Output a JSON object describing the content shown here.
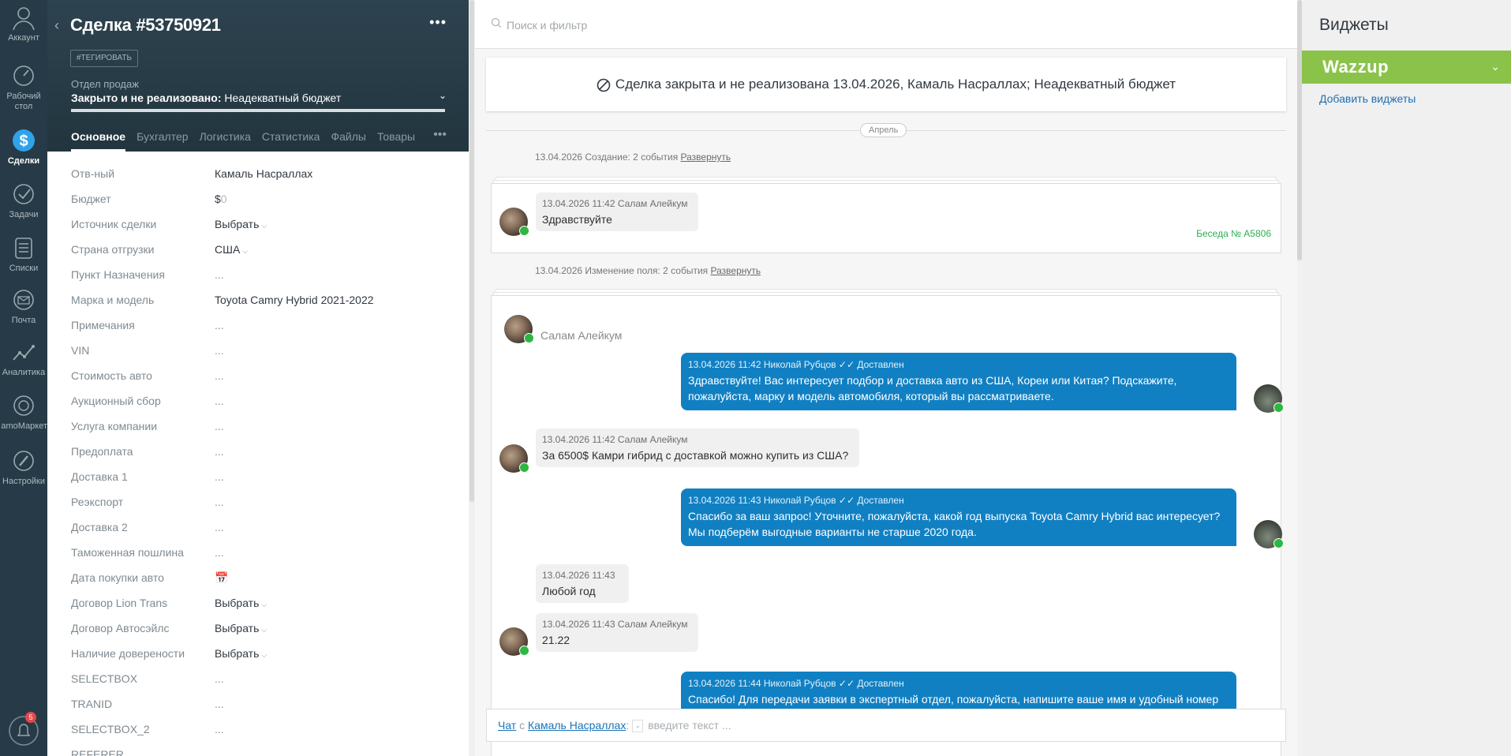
{
  "nav": {
    "items": [
      {
        "label": "Аккаунт",
        "icon": "account-icon"
      },
      {
        "label": "Рабочий стол",
        "icon": "dashboard-icon"
      },
      {
        "label": "Сделки",
        "icon": "deals-icon"
      },
      {
        "label": "Задачи",
        "icon": "tasks-icon"
      },
      {
        "label": "Списки",
        "icon": "lists-icon"
      },
      {
        "label": "Почта",
        "icon": "mail-icon"
      },
      {
        "label": "Аналитика",
        "icon": "analytics-icon"
      },
      {
        "label": "amoМаркет",
        "icon": "market-icon"
      },
      {
        "label": "Настройки",
        "icon": "settings-icon"
      }
    ],
    "notifications_count": "5"
  },
  "deal": {
    "title": "Сделка #53750921",
    "tag_button": "#ТЕГИРОВАТЬ",
    "pipeline": "Отдел продаж",
    "status_bold": "Закрыто и не реализовано:",
    "status_reason": " Неадекватный бюджет",
    "tabs": [
      "Основное",
      "Бухгалтер",
      "Логистика",
      "Статистика",
      "Файлы",
      "Товары"
    ],
    "fields": [
      {
        "label": "Отв-ный",
        "value": "Камаль Насраллах"
      },
      {
        "label": "Бюджет",
        "value": "$",
        "value_zero": "0"
      },
      {
        "label": "Источник сделки",
        "value": "Выбрать",
        "select": true
      },
      {
        "label": "Страна отгрузки",
        "value": "США",
        "select": true
      },
      {
        "label": "Пункт Назначения",
        "value": "..."
      },
      {
        "label": "Марка и модель",
        "value": "Toyota Camry Hybrid 2021-2022"
      },
      {
        "label": "Примечания",
        "value": "..."
      },
      {
        "label": "VIN",
        "value": "..."
      },
      {
        "label": "Стоимость авто",
        "value": "..."
      },
      {
        "label": "Аукционный сбор",
        "value": "..."
      },
      {
        "label": "Услуга компании",
        "value": "..."
      },
      {
        "label": "Предоплата",
        "value": "..."
      },
      {
        "label": "Доставка 1",
        "value": "..."
      },
      {
        "label": "Реэкспорт",
        "value": "..."
      },
      {
        "label": "Доставка 2",
        "value": "..."
      },
      {
        "label": "Таможенная пошлина",
        "value": "..."
      },
      {
        "label": "Дата покупки авто",
        "value": "📅"
      },
      {
        "label": "Договор Lion Trans",
        "value": "Выбрать",
        "select": true
      },
      {
        "label": "Договор Автосэйлс",
        "value": "Выбрать",
        "select": true
      },
      {
        "label": "Наличие доверености",
        "value": "Выбрать",
        "select": true
      },
      {
        "label": "SELECTBOX",
        "value": "..."
      },
      {
        "label": "TRANID",
        "value": "..."
      },
      {
        "label": "SELECTBOX_2",
        "value": "..."
      },
      {
        "label": "REFERER",
        "value": ""
      }
    ]
  },
  "feed": {
    "search_placeholder": "Поиск и фильтр",
    "closed_banner": "Сделка закрыта и не реализована 13.04.2026, Камаль Насраллах; Неадекватный бюджет",
    "month": "Апрель",
    "event1": {
      "text": "13.04.2026 Создание: 2 события ",
      "link": "Развернуть"
    },
    "event2": {
      "text": "13.04.2026 Изменение поля: 2 события ",
      "link": "Развернуть"
    },
    "card1": {
      "meta": "13.04.2026 11:42 Салам Алейкум",
      "text": "Здравствуйте",
      "conversation": "Беседа № A5806"
    },
    "sender_name": "Салам Алейкум",
    "messages": [
      {
        "dir": "out",
        "meta": "13.04.2026 11:42 Николай Рубцов",
        "status": "✓✓ Доставлен",
        "text": "Здравствуйте! Вас интересует подбор и доставка авто из США, Кореи или Китая? Подскажите, пожалуйста, марку и модель автомобиля, который вы рассматриваете."
      },
      {
        "dir": "in",
        "meta": "13.04.2026 11:42 Салам Алейкум",
        "text": "За 6500$ Камри гибрид с доставкой можно купить из США?"
      },
      {
        "dir": "out",
        "meta": "13.04.2026 11:43 Николай Рубцов",
        "status": "✓✓ Доставлен",
        "text": "Спасибо за ваш запрос! Уточните, пожалуйста, какой год выпуска Toyota Camry Hybrid вас интересует? Мы подберём выгодные варианты не старше 2020 года."
      },
      {
        "dir": "in",
        "meta": "13.04.2026 11:43",
        "text": "Любой год"
      },
      {
        "dir": "in",
        "meta": "13.04.2026 11:43 Салам Алейкум",
        "text": "21.22"
      },
      {
        "dir": "out",
        "meta": "13.04.2026 11:44 Николай Рубцов",
        "status": "✓✓ Доставлен",
        "text": "Спасибо! Для передачи заявки в экспертный отдел, пожалуйста, напишите ваше имя и удобный номер"
      }
    ],
    "chat": {
      "prefix_link": "Чат",
      "with": " с ",
      "contact_link": "Камаль Насраллах",
      "colon": ":",
      "placeholder": "введите текст ..."
    }
  },
  "widgets": {
    "title": "Виджеты",
    "wazzup": "Wazzup",
    "add": "Добавить виджеты"
  },
  "colors": {
    "nav_bg": "#263b47",
    "deal_header_bg": "#2a3f4b",
    "outgoing_bubble": "#1180c3",
    "wazzup_green": "#8bc34a",
    "whatsapp_green": "#2db742",
    "link_blue": "#1f6fb2"
  }
}
